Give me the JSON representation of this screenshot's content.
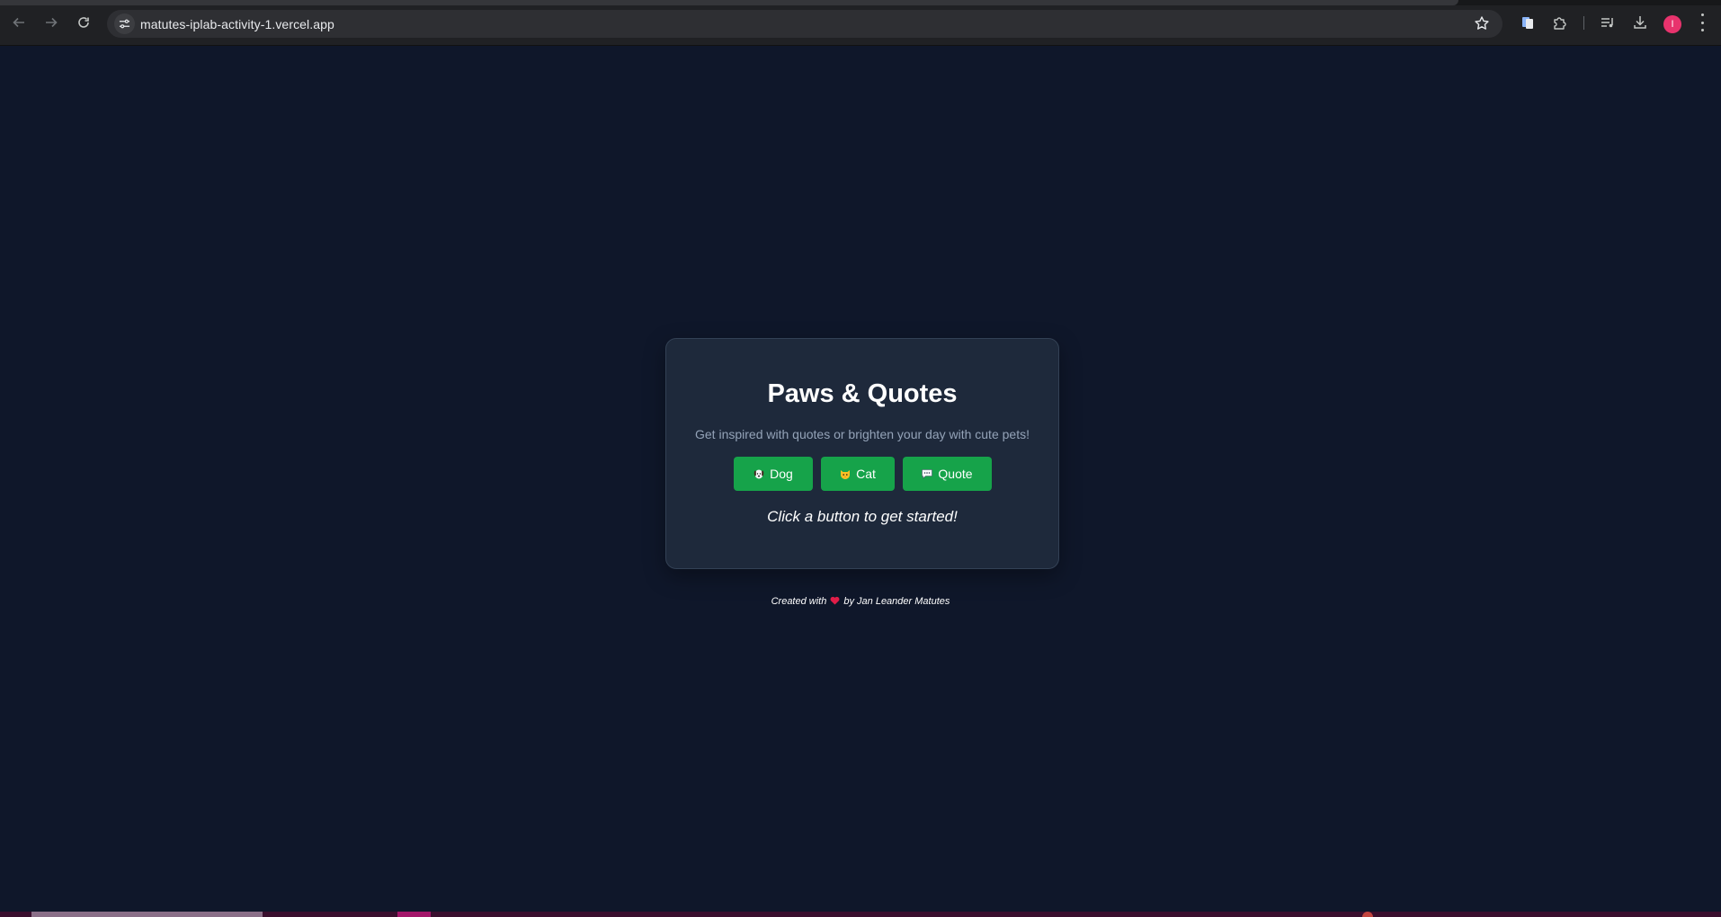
{
  "browser": {
    "url": "matutes-iplab-activity-1.vercel.app",
    "profile_initial": "I",
    "icons": {
      "back": "arrow-left-icon",
      "forward": "arrow-right-icon",
      "reload": "reload-icon",
      "site_info": "tune-icon",
      "bookmark": "star-icon",
      "extension1": "document-extension-icon",
      "extensions": "puzzle-icon",
      "media": "media-queue-icon",
      "downloads": "download-icon",
      "menu": "more-vertical-icon"
    }
  },
  "app": {
    "title": "Paws & Quotes",
    "subtitle": "Get inspired with quotes or brighten your day with cute pets!",
    "buttons": [
      {
        "label": "Dog",
        "icon": "dog-face-icon"
      },
      {
        "label": "Cat",
        "icon": "cat-face-icon"
      },
      {
        "label": "Quote",
        "icon": "speech-balloon-icon"
      }
    ],
    "hint": "Click a button to get started!"
  },
  "footer": {
    "before": "Created with",
    "after": "by Jan Leander Matutes",
    "icon": "heart-icon"
  },
  "colors": {
    "page_bg": "#0f172a",
    "card_bg": "#1e293b",
    "button_bg": "#16a34a",
    "subtitle": "#94a3b8",
    "avatar": "#e8336d",
    "heart": "#e11d48"
  }
}
